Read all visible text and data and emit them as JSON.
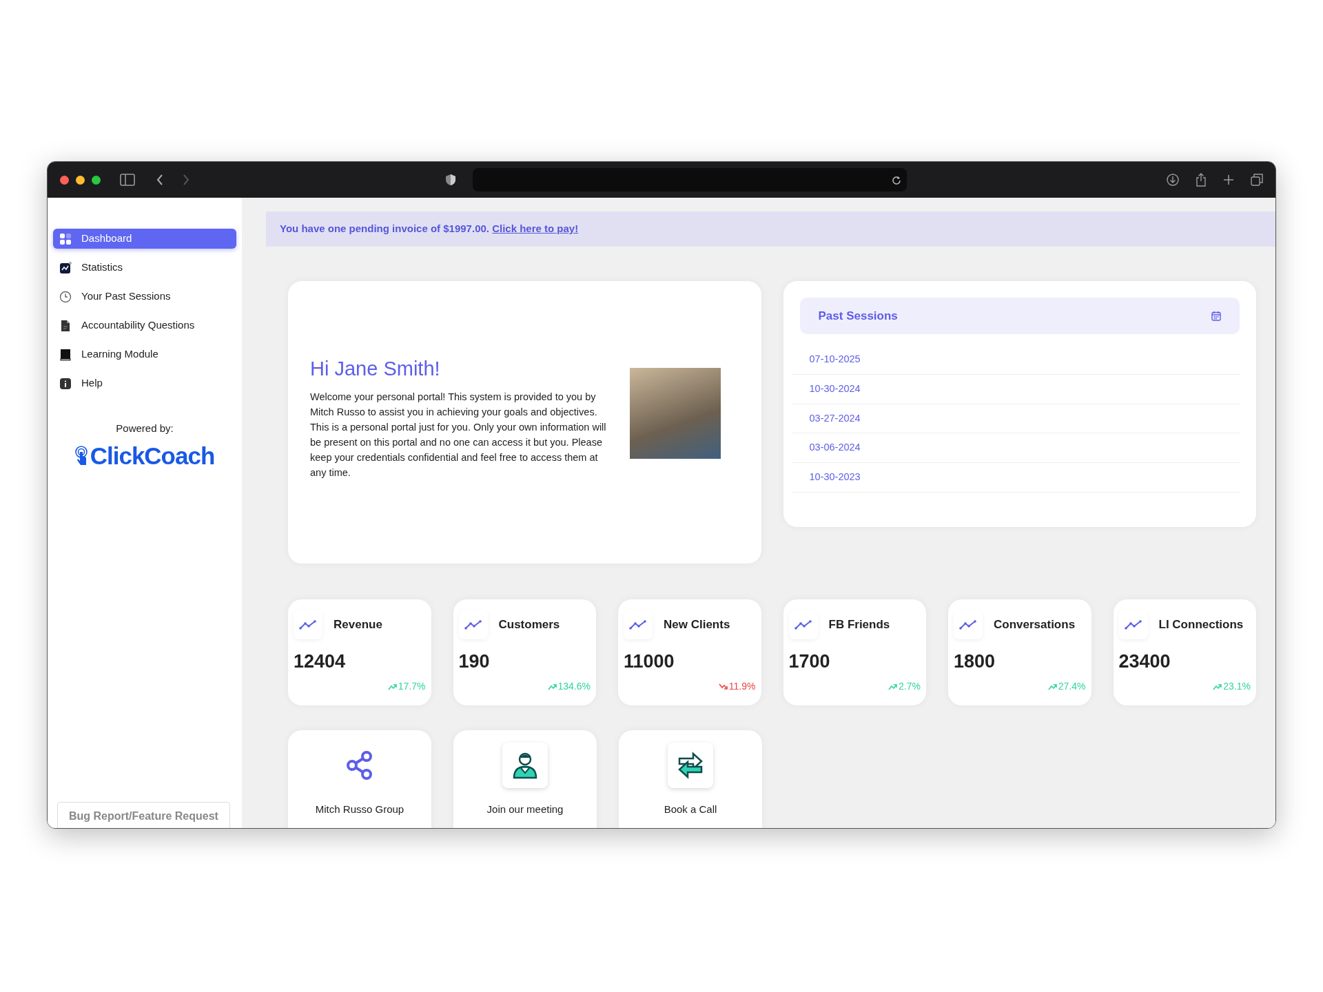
{
  "sidebar": {
    "items": [
      {
        "label": "Dashboard",
        "kind": "grid",
        "selected": true
      },
      {
        "label": "Statistics",
        "kind": "chart",
        "selected": false
      },
      {
        "label": "Your Past Sessions",
        "kind": "clock",
        "selected": false
      },
      {
        "label": "Accountability Questions",
        "kind": "document",
        "selected": false
      },
      {
        "label": "Learning Module",
        "kind": "book",
        "selected": false
      },
      {
        "label": "Help",
        "kind": "info",
        "selected": false
      }
    ],
    "powered_by": "Powered by:",
    "logo": "ClickCoach",
    "bug_report": "Bug Report/Feature Request"
  },
  "banner": {
    "text": "You have one pending invoice of $1997.00.",
    "link": "Click here to pay!"
  },
  "greeting": {
    "title": "Hi Jane Smith!",
    "body": "Welcome your personal portal! This system is provided to you by Mitch Russo to assist you in achieving your goals and objectives. This is a personal portal just for you. Only your own information will be present on this portal and no one can access it but you. Please keep your credentials confidential and feel free to access them at any time."
  },
  "past_sessions": {
    "title": "Past Sessions",
    "dates": [
      "07-10-2025",
      "10-30-2024",
      "03-27-2024",
      "03-06-2024",
      "10-30-2023"
    ]
  },
  "stats": [
    {
      "label": "Revenue",
      "value": "12404",
      "change": "17.7%",
      "kind": "up"
    },
    {
      "label": "Customers",
      "value": "190",
      "change": "134.6%",
      "kind": "up"
    },
    {
      "label": "New Clients",
      "value": "11000",
      "change": "11.9%",
      "kind": "down"
    },
    {
      "label": "FB Friends",
      "value": "1700",
      "change": "2.7%",
      "kind": "up"
    },
    {
      "label": "Conversations",
      "value": "1800",
      "change": "27.4%",
      "kind": "up"
    },
    {
      "label": "LI Connections",
      "value": "23400",
      "change": "23.1%",
      "kind": "up"
    }
  ],
  "links": [
    {
      "label": "Mitch Russo Group",
      "kind": "share"
    },
    {
      "label": "Join our meeting",
      "kind": "person"
    },
    {
      "label": "Book a Call",
      "kind": "arrows"
    }
  ]
}
